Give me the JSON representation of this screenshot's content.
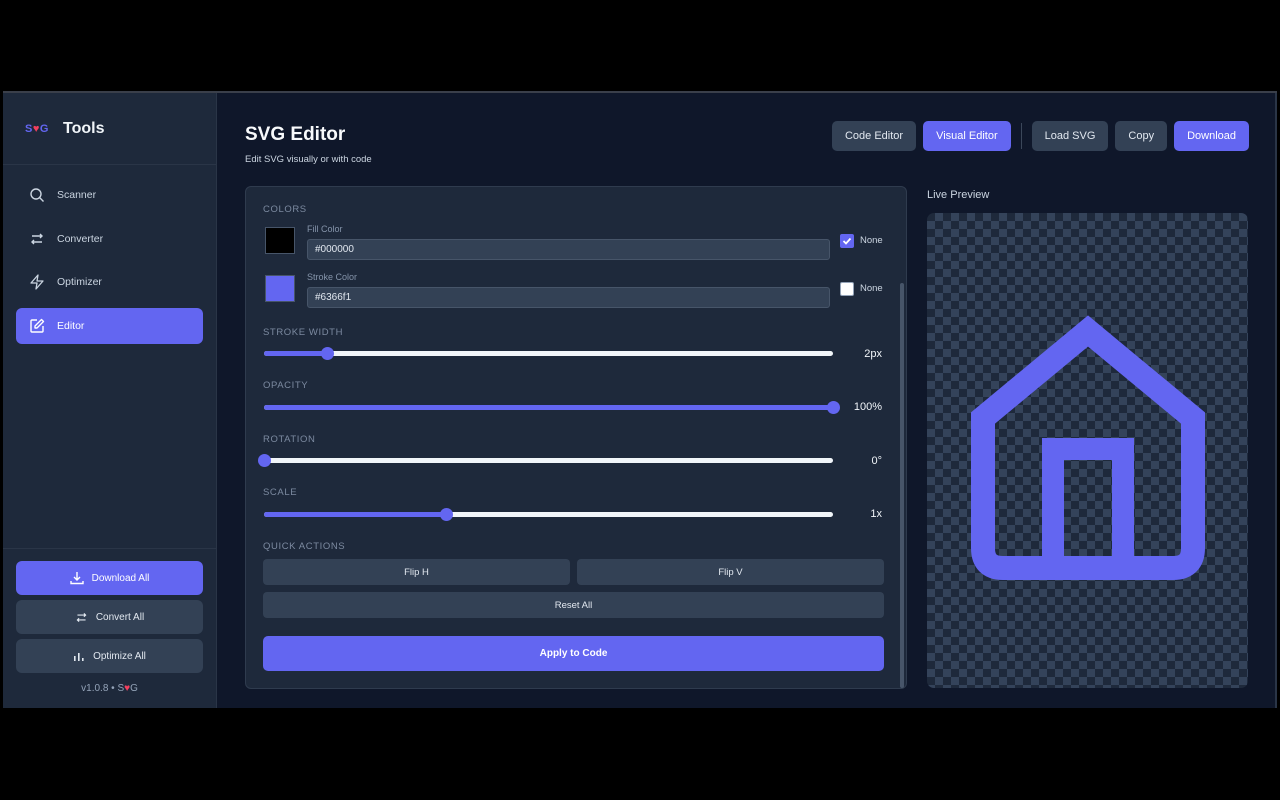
{
  "sidebar": {
    "logo": {
      "pre": "S",
      "heart": "♥",
      "post": "G"
    },
    "title": "Tools",
    "items": [
      {
        "label": "Scanner",
        "icon": "search-icon"
      },
      {
        "label": "Converter",
        "icon": "convert-icon"
      },
      {
        "label": "Optimizer",
        "icon": "lightning-icon"
      },
      {
        "label": "Editor",
        "icon": "edit-icon",
        "active": true
      }
    ],
    "actions": {
      "download_all": "Download All",
      "convert_all": "Convert All",
      "optimize_all": "Optimize All"
    },
    "version": {
      "prefix": "v1.0.8 • S",
      "heart": "♥",
      "post": "G"
    }
  },
  "header": {
    "title": "SVG Editor",
    "subtitle": "Edit SVG visually or with code",
    "buttons": {
      "code_editor": "Code Editor",
      "visual_editor": "Visual Editor",
      "load_svg": "Load SVG",
      "copy": "Copy",
      "download": "Download"
    }
  },
  "editor": {
    "colors_heading": "COLORS",
    "fill": {
      "label": "Fill Color",
      "value": "#000000",
      "none_checked": true,
      "none_label": "None"
    },
    "stroke": {
      "label": "Stroke Color",
      "value": "#6366f1",
      "none_checked": false,
      "none_label": "None"
    },
    "sliders": {
      "stroke_width": {
        "label": "STROKE WIDTH",
        "display": "2px",
        "fraction": 0.11
      },
      "opacity": {
        "label": "OPACITY",
        "display": "100%",
        "fraction": 1.0
      },
      "rotation": {
        "label": "ROTATION",
        "display": "0°",
        "fraction": 0.0
      },
      "scale": {
        "label": "SCALE",
        "display": "1x",
        "fraction": 0.32
      }
    },
    "quick_actions_heading": "QUICK ACTIONS",
    "quick_actions": {
      "flip_h": "Flip H",
      "flip_v": "Flip V",
      "reset": "Reset All"
    },
    "apply": "Apply to Code"
  },
  "preview": {
    "label": "Live Preview",
    "icon": "house-icon",
    "fill_color": "#000000",
    "stroke_color": "#6366f1",
    "checker_color": "#34435a",
    "background_color": "#1e293b"
  },
  "colors": {
    "accent": "#6366f1",
    "heart": "#f43f5e",
    "sidebar_bg": "#1e293b",
    "main_bg": "#0f172a"
  }
}
